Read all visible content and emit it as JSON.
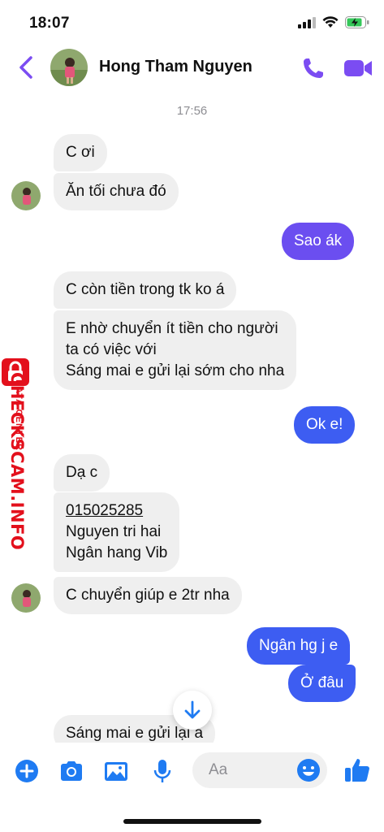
{
  "status_bar": {
    "time": "18:07"
  },
  "header": {
    "contact_name": "Hong Tham Nguyen"
  },
  "timestamp": "17:56",
  "messages": [
    {
      "side": "in",
      "text": "C ơi"
    },
    {
      "side": "in",
      "text": "Ăn tối chưa đó"
    },
    {
      "side": "out",
      "text": "Sao ák"
    },
    {
      "side": "in",
      "text": "C còn tiền trong tk ko á"
    },
    {
      "side": "in",
      "lines": [
        "E nhờ chuyển ít tiền cho người",
        "ta có việc với",
        "Sáng mai e gửi lại sớm cho nha"
      ]
    },
    {
      "side": "out",
      "text": "Ok e!"
    },
    {
      "side": "in",
      "text": "Dạ c"
    },
    {
      "side": "in",
      "lines": [
        "015025285",
        "Nguyen tri hai",
        "Ngân hang Vib"
      ]
    },
    {
      "side": "in",
      "text": "C chuyển giúp e 2tr nha"
    },
    {
      "side": "out",
      "text": "Ngân hg j e"
    },
    {
      "side": "out",
      "text": "Ở đâu"
    },
    {
      "side": "in",
      "text": "Sáng mai e gửi lại á"
    }
  ],
  "watermark": {
    "brand": "CHECKSCAM.INFO",
    "sub": "DATA CENTER"
  },
  "composer": {
    "placeholder": "Aa"
  },
  "colors": {
    "accent": "#7b4cf2",
    "outgoing_purple": "#6b4ef0",
    "outgoing_blue": "#3d5df2",
    "incoming": "#efefef",
    "icon_blue": "#1f7bf2",
    "watermark_red": "#e3101c"
  }
}
